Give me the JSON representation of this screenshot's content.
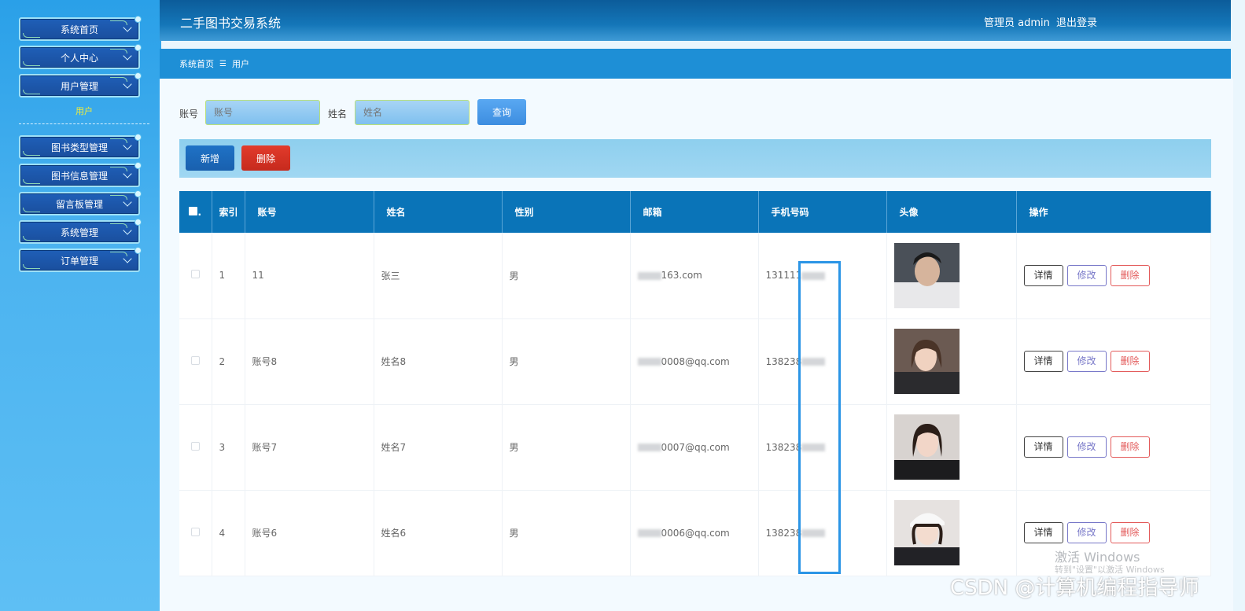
{
  "sidebar": {
    "items": [
      {
        "label": "系统首页"
      },
      {
        "label": "个人中心"
      },
      {
        "label": "用户管理"
      },
      {
        "label": "图书类型管理"
      },
      {
        "label": "图书信息管理"
      },
      {
        "label": "留言板管理"
      },
      {
        "label": "系统管理"
      },
      {
        "label": "订单管理"
      }
    ],
    "submenu_label": "用户"
  },
  "header": {
    "title": "二手图书交易系统",
    "admin": "管理员 admin",
    "logout": "退出登录"
  },
  "breadcrumb": {
    "home": "系统首页",
    "separator": "☰",
    "current": "用户"
  },
  "search": {
    "account_label": "账号",
    "account_placeholder": "账号",
    "name_label": "姓名",
    "name_placeholder": "姓名",
    "query_button": "查询"
  },
  "actions": {
    "add": "新增",
    "delete": "删除"
  },
  "table": {
    "headers": [
      "索引",
      "账号",
      "姓名",
      "性别",
      "邮箱",
      "手机号码",
      "头像",
      "操作"
    ],
    "rows": [
      {
        "index": "1",
        "account": "11",
        "name": "张三",
        "gender": "男",
        "email": "163.com",
        "phone": "131111"
      },
      {
        "index": "2",
        "account": "账号8",
        "name": "姓名8",
        "gender": "男",
        "email": "0008@qq.com",
        "phone": "138238"
      },
      {
        "index": "3",
        "account": "账号7",
        "name": "姓名7",
        "gender": "男",
        "email": "0007@qq.com",
        "phone": "138238"
      },
      {
        "index": "4",
        "account": "账号6",
        "name": "姓名6",
        "gender": "男",
        "email": "0006@qq.com",
        "phone": "138238"
      }
    ],
    "op_labels": {
      "detail": "详情",
      "edit": "修改",
      "delete": "删除"
    }
  },
  "watermarks": {
    "windows_line1": "激活 Windows",
    "windows_line2": "转到\"设置\"以激活 Windows",
    "csdn": "CSDN @计算机编程指导师"
  }
}
